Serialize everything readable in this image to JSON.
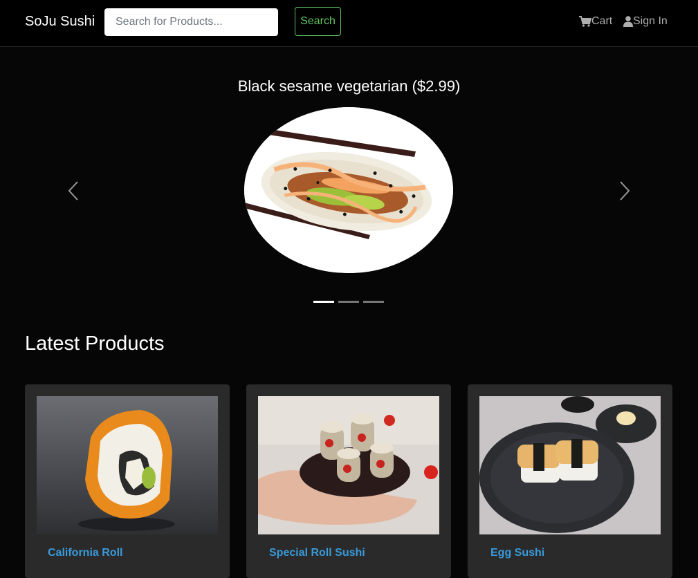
{
  "navbar": {
    "brand": "SoJu Sushi",
    "search_placeholder": "Search for Products...",
    "search_button": "Search",
    "cart_label": "Cart",
    "signin_label": "Sign In",
    "cart_icon": "cart-icon",
    "user_icon": "user-icon"
  },
  "carousel": {
    "caption": "Black sesame vegetarian ($2.99)",
    "slide_count": 3,
    "active_slide": 1
  },
  "latest": {
    "title": "Latest Products",
    "products": [
      {
        "name": "California Roll"
      },
      {
        "name": "Special Roll Sushi"
      },
      {
        "name": "Egg Sushi"
      }
    ]
  },
  "colors": {
    "background": "#060606",
    "navbar": "#000000",
    "card": "#2a2a2a",
    "link": "#3a9ad9",
    "search_button": "#62c462"
  }
}
